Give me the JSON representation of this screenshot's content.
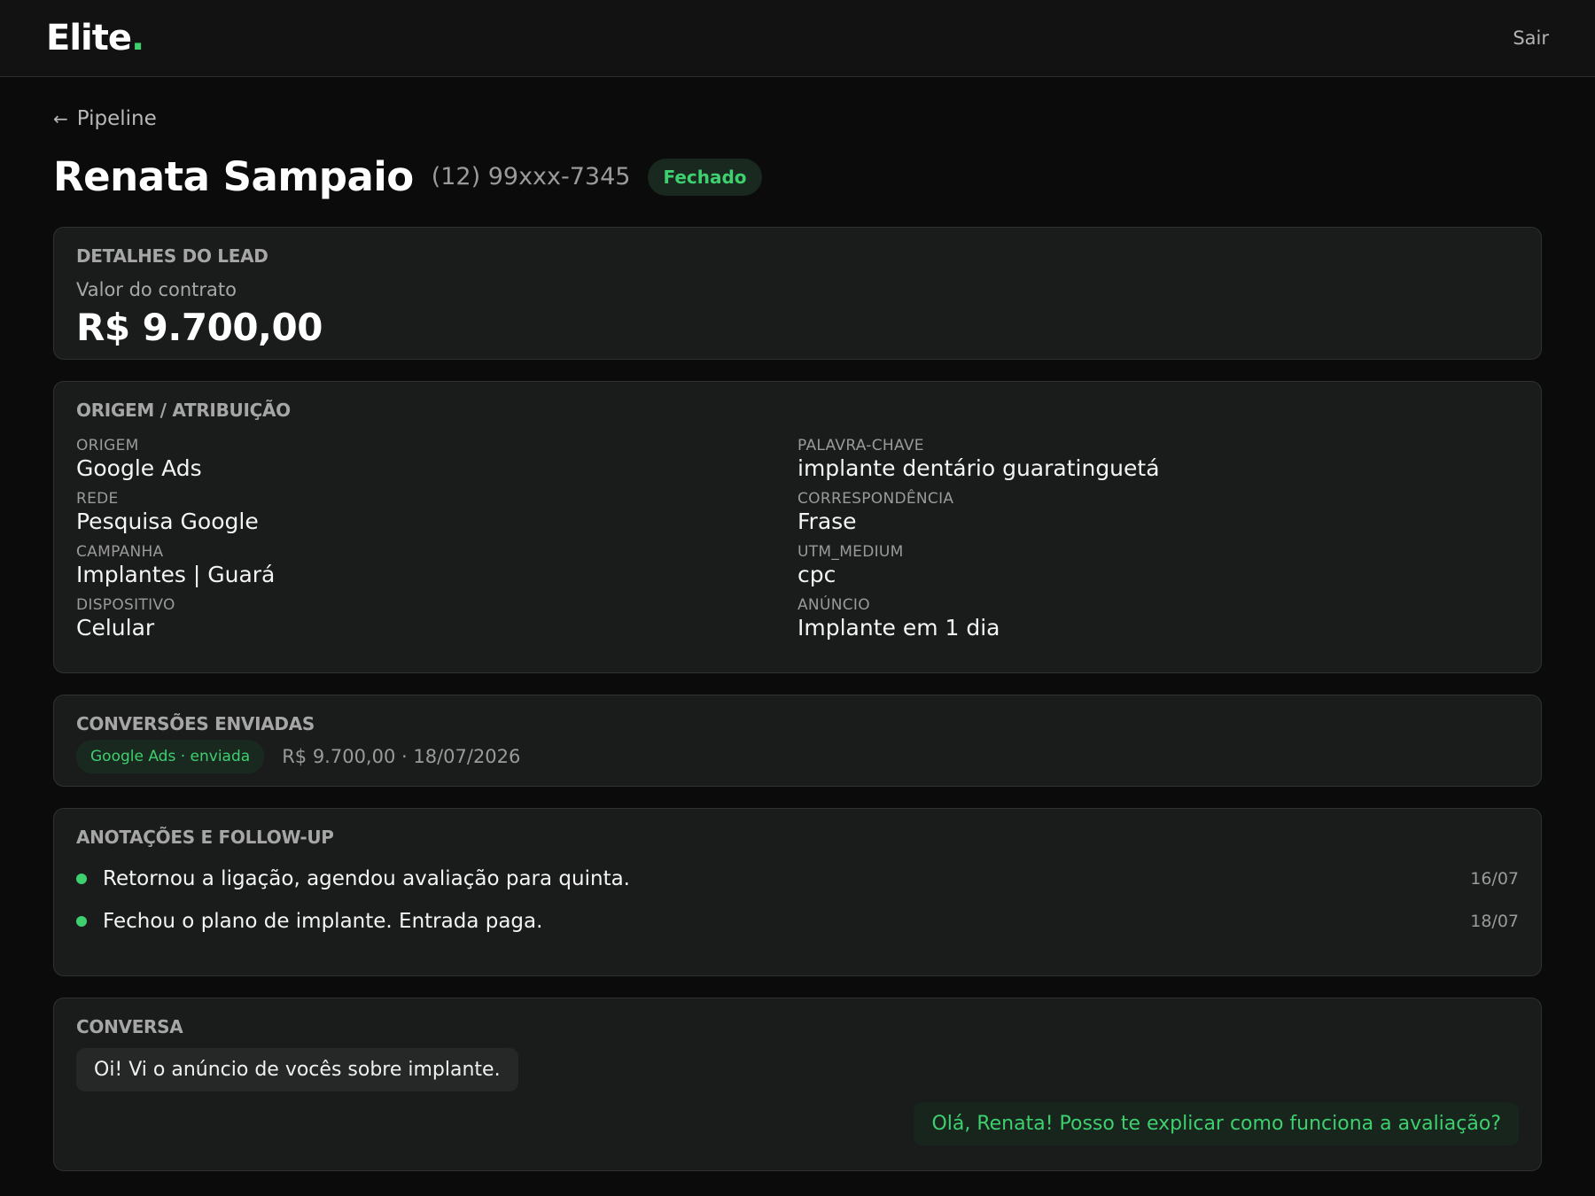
{
  "app": {
    "logo_text": "Elite",
    "logo_dot": ".",
    "logout_label": "Sair"
  },
  "nav": {
    "back_arrow": "←",
    "back_label": "Pipeline"
  },
  "lead": {
    "name": "Renata Sampaio",
    "phone": "(12) 99xxx-7345",
    "status": "Fechado"
  },
  "details": {
    "title": "DETALHES DO LEAD",
    "contract_label": "Valor do contrato",
    "contract_value": "R$ 9.700,00"
  },
  "origin": {
    "title": "ORIGEM / ATRIBUIÇÃO",
    "fields": [
      {
        "label": "ORIGEM",
        "value": "Google Ads"
      },
      {
        "label": "PALAVRA-CHAVE",
        "value": "implante dentário guaratinguetá"
      },
      {
        "label": "REDE",
        "value": "Pesquisa Google"
      },
      {
        "label": "CORRESPONDÊNCIA",
        "value": "Frase"
      },
      {
        "label": "CAMPANHA",
        "value": "Implantes | Guará"
      },
      {
        "label": "UTM_MEDIUM",
        "value": "cpc"
      },
      {
        "label": "DISPOSITIVO",
        "value": "Celular"
      },
      {
        "label": "ANÚNCIO",
        "value": "Implante em 1 dia"
      }
    ]
  },
  "conversions": {
    "title": "CONVERSÕES ENVIADAS",
    "items": [
      {
        "badge": "Google Ads · enviada",
        "meta": "R$ 9.700,00 · 18/07/2026"
      }
    ]
  },
  "notes": {
    "title": "ANOTAÇÕES E FOLLOW-UP",
    "items": [
      {
        "text": "Retornou a ligação, agendou avaliação para quinta.",
        "date": "16/07"
      },
      {
        "text": "Fechou o plano de implante. Entrada paga.",
        "date": "18/07"
      }
    ]
  },
  "chat": {
    "title": "CONVERSA",
    "messages": [
      {
        "from": "lead",
        "text": "Oi! Vi o anúncio de vocês sobre implante."
      },
      {
        "from": "agent",
        "text": "Olá, Renata! Posso te explicar como funciona a avaliação?"
      }
    ]
  },
  "colors": {
    "accent": "#3ecf6e",
    "background": "#0b0b0b",
    "card": "#1a1b1b"
  }
}
